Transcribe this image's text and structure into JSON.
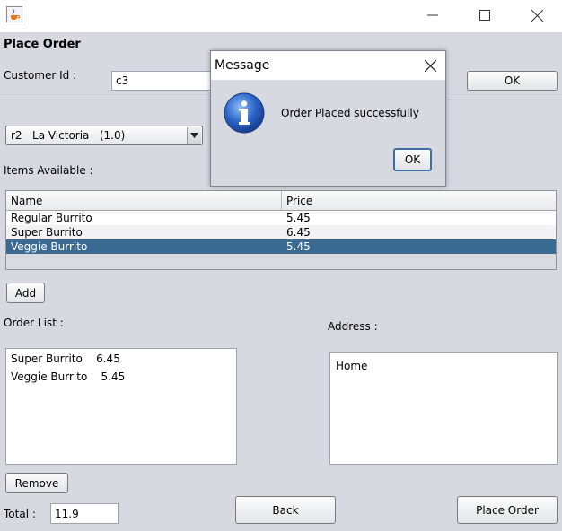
{
  "window": {
    "controls": {
      "minimize": "minimize-icon",
      "maximize": "maximize-icon",
      "close": "close-icon"
    }
  },
  "form": {
    "heading": "Place Order",
    "customer_label": "Customer Id :",
    "customer_value": "c3",
    "ok_label": "OK",
    "restaurant_selected": "r2   La Victoria   (1.0)",
    "items_label": "Items Available :",
    "table": {
      "columns": [
        "Name",
        "Price"
      ],
      "rows": [
        {
          "name": "Regular Burrito",
          "price": "5.45"
        },
        {
          "name": "Super Burrito",
          "price": "6.45"
        },
        {
          "name": "Veggie Burrito",
          "price": "5.45"
        }
      ],
      "selected_index": 2
    },
    "add_label": "Add",
    "order_list_label": "Order List :",
    "order_list": [
      "Super Burrito    6.45",
      "Veggie Burrito    5.45"
    ],
    "address_label": "Address :",
    "address_value": "Home",
    "remove_label": "Remove",
    "total_label": "Total :",
    "total_value": "11.9",
    "back_label": "Back",
    "place_order_label": "Place Order"
  },
  "dialog": {
    "title": "Message",
    "message": "Order Placed successfully",
    "ok_label": "OK",
    "icon": "information-icon"
  },
  "colors": {
    "background": "#d6d9df",
    "selection": "#3a6a92",
    "info_icon": "#2a64c8"
  }
}
